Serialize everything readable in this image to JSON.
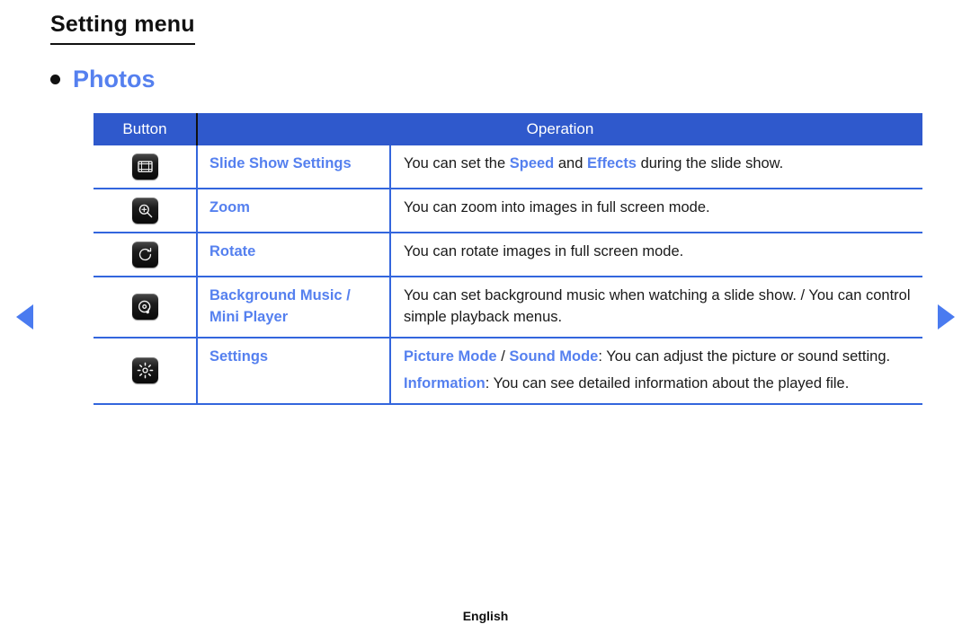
{
  "page": {
    "title": "Setting menu",
    "footer_language": "English"
  },
  "section": {
    "bullet_icon": "bullet-dot-icon",
    "label": "Photos"
  },
  "colors": {
    "header_blue": "#2f59cc",
    "link_blue": "#5580ef",
    "row_border_blue": "#3366dd",
    "arrow_blue": "#4a7bf0",
    "text_black": "#1a1a1a"
  },
  "nav": {
    "prev_label": "Previous page",
    "prev_icon": "triangle-left-icon",
    "next_label": "Next page",
    "next_icon": "triangle-right-icon"
  },
  "table": {
    "columns": [
      "Button",
      "Operation"
    ],
    "rows": [
      {
        "icon": "slide-show-settings-icon",
        "name": "Slide Show Settings",
        "desc_parts": [
          [
            {
              "t": "You can set the ",
              "hl": false
            },
            {
              "t": "Speed",
              "hl": true
            },
            {
              "t": " and ",
              "hl": false
            },
            {
              "t": "Effects",
              "hl": true
            },
            {
              "t": " during the slide show.",
              "hl": false
            }
          ]
        ]
      },
      {
        "icon": "zoom-in-icon",
        "name": "Zoom",
        "desc_parts": [
          [
            {
              "t": "You can zoom into images in full screen mode.",
              "hl": false
            }
          ]
        ]
      },
      {
        "icon": "rotate-icon",
        "name": "Rotate",
        "desc_parts": [
          [
            {
              "t": "You can rotate images in full screen mode.",
              "hl": false
            }
          ]
        ]
      },
      {
        "icon": "background-music-icon",
        "name": "Background Music / Mini Player",
        "desc_parts": [
          [
            {
              "t": "You can set background music when watching a slide show. / You can control simple playback menus.",
              "hl": false
            }
          ]
        ]
      },
      {
        "icon": "settings-gear-icon",
        "name": "Settings",
        "desc_parts": [
          [
            {
              "t": "Picture Mode",
              "hl": true
            },
            {
              "t": " / ",
              "hl": false
            },
            {
              "t": "Sound Mode",
              "hl": true
            },
            {
              "t": ": You can adjust the picture or sound setting.",
              "hl": false
            }
          ],
          [
            {
              "t": "Information",
              "hl": true
            },
            {
              "t": ": You can see detailed information about the played file.",
              "hl": false
            }
          ]
        ]
      }
    ]
  }
}
